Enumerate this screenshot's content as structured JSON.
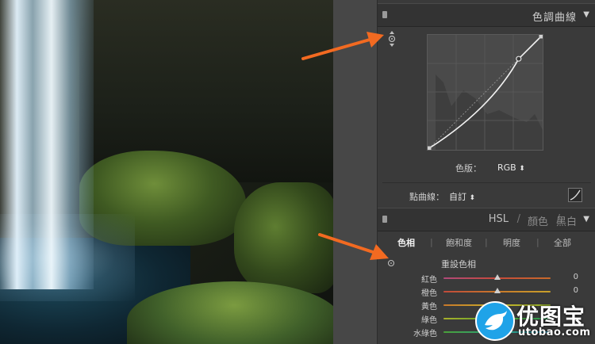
{
  "tone_curve_panel": {
    "title": "色調曲線",
    "channel_label": "色版：",
    "channel_value": "RGB",
    "point_curve_label": "點曲線：",
    "point_curve_value": "自訂",
    "curve_points": [
      [
        0,
        0
      ],
      [
        0.8,
        0.8
      ],
      [
        1,
        1
      ]
    ]
  },
  "hsl_panel": {
    "header_hsl": "HSL",
    "header_sep1": "/",
    "header_color": "顏色",
    "header_sep2": "/",
    "header_bw": "黑白",
    "tabs": [
      "色相",
      "飽和度",
      "明度",
      "全部"
    ],
    "active_tab": "色相",
    "section_title": "重設色相",
    "rows": [
      {
        "label": "紅色",
        "value": "0",
        "level": 0.5
      },
      {
        "label": "橙色",
        "value": "0",
        "level": 0.5
      },
      {
        "label": "黃色",
        "value": "",
        "level": 0.52
      },
      {
        "label": "綠色",
        "value": "",
        "level": 0.5
      },
      {
        "label": "水綠色",
        "value": "",
        "level": 0.5
      }
    ]
  },
  "watermark": {
    "name": "优图宝",
    "domain": "utobao.com"
  },
  "colors": {
    "arrow": "#f26a21",
    "panel_bg": "#3a3a3a",
    "logo_blue": "#1fa3e8"
  }
}
